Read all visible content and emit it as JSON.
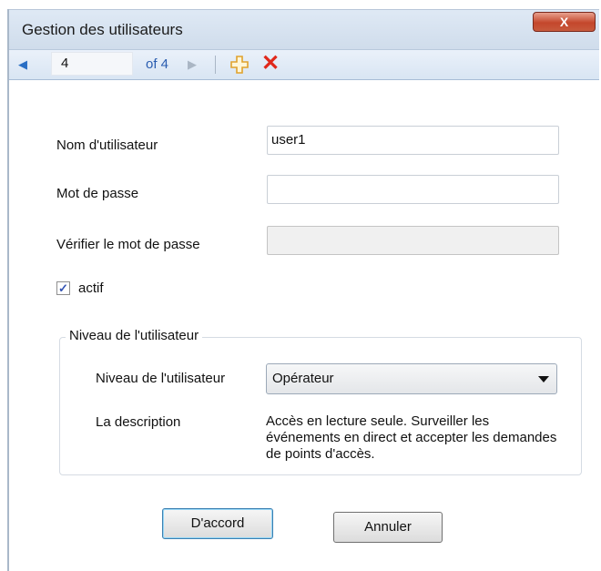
{
  "window": {
    "title": "Gestion des utilisateurs",
    "close_label": "X"
  },
  "toolbar": {
    "position": "4",
    "of_label": "of 4"
  },
  "form": {
    "username_label": "Nom d'utilisateur",
    "username_value": "user1",
    "password_label": "Mot de passe",
    "password_value": "",
    "verify_label": "Vérifier le mot de passe",
    "verify_value": "",
    "active_label": "actif",
    "active_checked": true,
    "active_check_glyph": "✓"
  },
  "level_group": {
    "legend": "Niveau de l'utilisateur",
    "level_label": "Niveau de l'utilisateur",
    "level_value": "Opérateur",
    "description_label": "La description",
    "description_text": "Accès en lecture seule. Surveiller les événements en direct et accepter les demandes de points d'accès."
  },
  "buttons": {
    "ok_label": "D'accord",
    "cancel_label": "Annuler"
  },
  "colors": {
    "accent": "#2a6fc4",
    "delete": "#e0281b",
    "add": "#f0b53a",
    "close": "#c4472c"
  },
  "icons": {
    "prev": "triangle-left-icon",
    "next": "triangle-right-icon",
    "add": "plus-icon",
    "delete": "x-icon",
    "close": "close-icon"
  }
}
